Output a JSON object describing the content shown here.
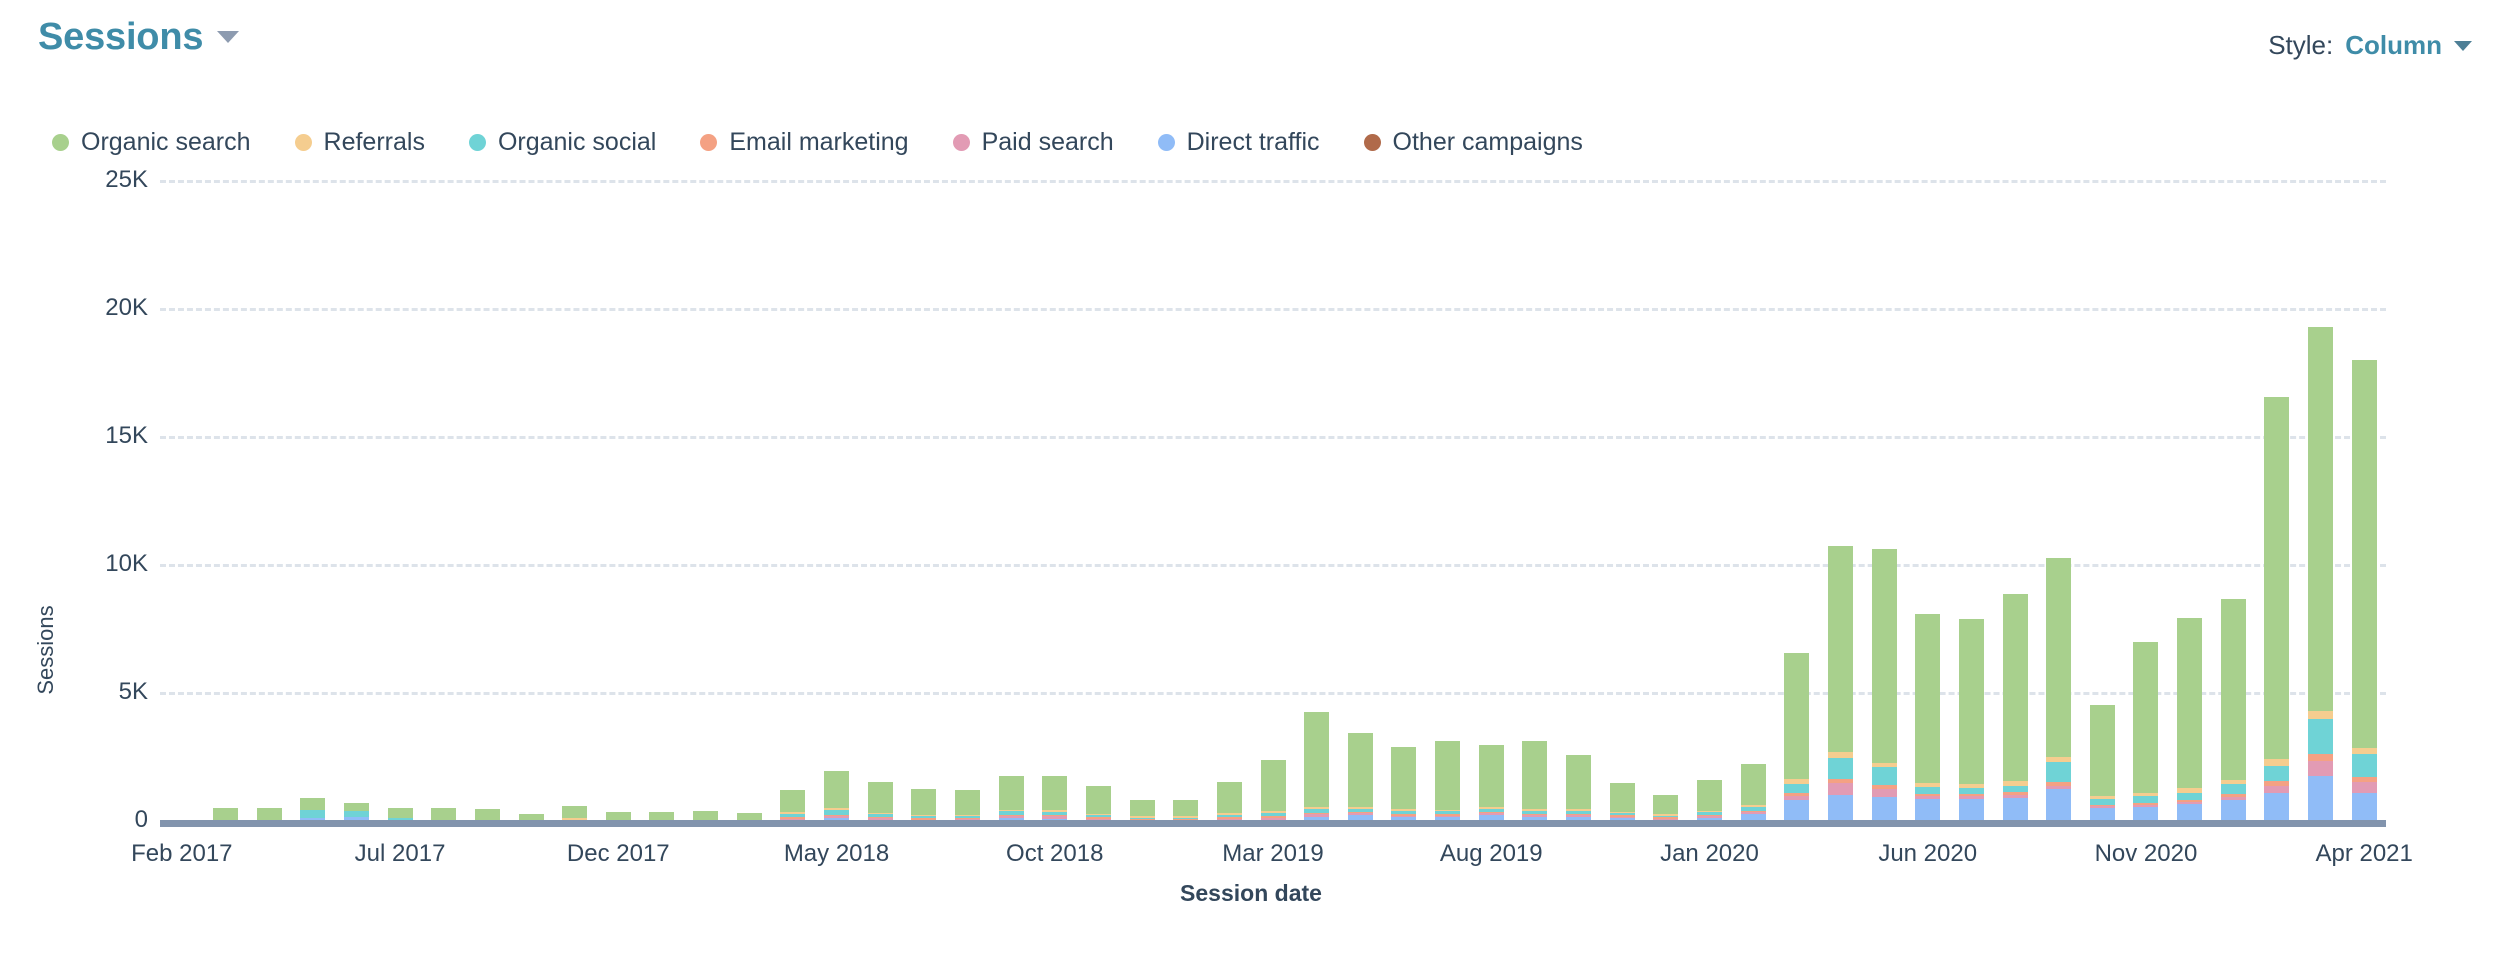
{
  "header": {
    "metric_title": "Sessions",
    "metric_caret_icon": "chevron-down-icon",
    "style_label": "Style:",
    "style_value": "Column",
    "style_caret_icon": "chevron-down-icon"
  },
  "legend": {
    "items": [
      {
        "label": "Organic search",
        "color": "#a8d08d"
      },
      {
        "label": "Referrals",
        "color": "#f5cd8f"
      },
      {
        "label": "Organic social",
        "color": "#6fd3d6"
      },
      {
        "label": "Email marketing",
        "color": "#f4a183"
      },
      {
        "label": "Paid search",
        "color": "#e29bb4"
      },
      {
        "label": "Direct traffic",
        "color": "#90bcf7"
      },
      {
        "label": "Other campaigns",
        "color": "#b06a4a"
      }
    ]
  },
  "chart_data": {
    "type": "bar",
    "stacked": true,
    "title": "Sessions",
    "xlabel": "Session date",
    "ylabel": "Sessions",
    "ylim": [
      0,
      25000
    ],
    "ytick_values": [
      0,
      5000,
      10000,
      15000,
      20000,
      25000
    ],
    "ytick_labels": [
      "0",
      "5K",
      "10K",
      "15K",
      "20K",
      "25K"
    ],
    "grid": true,
    "grid_style": "dashed-horizontal",
    "legend_position": "top-left",
    "xtick_labels": [
      "Feb 2017",
      "Jul 2017",
      "Dec 2017",
      "May 2018",
      "Oct 2018",
      "Mar 2019",
      "Aug 2019",
      "Jan 2020",
      "Jun 2020",
      "Nov 2020",
      "Apr 2021"
    ],
    "xtick_indices": [
      0,
      5,
      10,
      15,
      20,
      25,
      30,
      35,
      40,
      45,
      50
    ],
    "categories": [
      "Feb 2017",
      "Mar 2017",
      "Apr 2017",
      "May 2017",
      "Jun 2017",
      "Jul 2017",
      "Aug 2017",
      "Sep 2017",
      "Oct 2017",
      "Nov 2017",
      "Dec 2017",
      "Jan 2018",
      "Feb 2018",
      "Mar 2018",
      "Apr 2018",
      "May 2018",
      "Jun 2018",
      "Jul 2018",
      "Aug 2018",
      "Sep 2018",
      "Oct 2018",
      "Nov 2018",
      "Dec 2018",
      "Jan 2019",
      "Feb 2019",
      "Mar 2019",
      "Apr 2019",
      "May 2019",
      "Jun 2019",
      "Jul 2019",
      "Aug 2019",
      "Sep 2019",
      "Oct 2019",
      "Nov 2019",
      "Dec 2019",
      "Jan 2020",
      "Feb 2020",
      "Mar 2020",
      "Apr 2020",
      "May 2020",
      "Jun 2020",
      "Jul 2020",
      "Aug 2020",
      "Sep 2020",
      "Oct 2020",
      "Nov 2020",
      "Dec 2020",
      "Jan 2021",
      "Feb 2021",
      "Mar 2021",
      "Apr 2021"
    ],
    "series": [
      {
        "name": "Direct traffic",
        "color": "#90bcf7",
        "values": [
          10,
          60,
          20,
          330,
          340,
          170,
          60,
          100,
          30,
          40,
          50,
          60,
          60,
          50,
          230,
          330,
          250,
          180,
          200,
          300,
          290,
          230,
          150,
          140,
          210,
          230,
          350,
          420,
          350,
          340,
          420,
          370,
          370,
          300,
          220,
          330,
          480,
          1000,
          1200,
          1150,
          1050,
          1050,
          1100,
          1450,
          700,
          750,
          850,
          1000,
          1300,
          1950,
          1300
        ]
      },
      {
        "name": "Paid search",
        "color": "#e29bb4",
        "values": [
          0,
          0,
          0,
          0,
          0,
          0,
          0,
          0,
          0,
          30,
          0,
          0,
          0,
          0,
          20,
          30,
          20,
          20,
          20,
          90,
          90,
          60,
          20,
          20,
          80,
          100,
          110,
          70,
          60,
          50,
          70,
          60,
          60,
          40,
          30,
          40,
          60,
          170,
          480,
          310,
          110,
          110,
          110,
          130,
          70,
          80,
          70,
          130,
          250,
          600,
          410
        ]
      },
      {
        "name": "Email marketing",
        "color": "#f4a183",
        "values": [
          0,
          0,
          0,
          0,
          0,
          0,
          0,
          0,
          0,
          40,
          0,
          0,
          0,
          0,
          20,
          20,
          20,
          20,
          20,
          30,
          30,
          20,
          20,
          20,
          30,
          40,
          50,
          40,
          40,
          40,
          50,
          40,
          40,
          30,
          20,
          30,
          60,
          130,
          160,
          140,
          110,
          110,
          110,
          150,
          70,
          80,
          80,
          120,
          220,
          280,
          200
        ]
      },
      {
        "name": "Organic social",
        "color": "#6fd3d6",
        "values": [
          0,
          0,
          0,
          310,
          260,
          160,
          40,
          0,
          0,
          60,
          70,
          60,
          60,
          40,
          130,
          180,
          100,
          90,
          70,
          120,
          110,
          80,
          60,
          50,
          90,
          110,
          140,
          120,
          110,
          110,
          130,
          110,
          110,
          90,
          60,
          90,
          130,
          350,
          820,
          690,
          250,
          220,
          260,
          780,
          200,
          250,
          310,
          380,
          580,
          1350,
          900
        ]
      },
      {
        "name": "Referrals",
        "color": "#f5cd8f",
        "values": [
          0,
          0,
          0,
          0,
          0,
          0,
          50,
          60,
          0,
          30,
          50,
          40,
          40,
          30,
          60,
          70,
          50,
          50,
          40,
          60,
          60,
          50,
          40,
          30,
          60,
          70,
          80,
          70,
          70,
          60,
          80,
          70,
          70,
          50,
          40,
          50,
          80,
          170,
          230,
          190,
          160,
          150,
          170,
          200,
          120,
          140,
          160,
          180,
          260,
          330,
          250
        ]
      },
      {
        "name": "Organic search",
        "color": "#a8d08d",
        "values": [
          20,
          640,
          640,
          450,
          300,
          390,
          510,
          510,
          410,
          480,
          380,
          350,
          400,
          330,
          880,
          1450,
          1200,
          1010,
          950,
          1340,
          1360,
          1060,
          630,
          640,
          1230,
          2020,
          3700,
          2900,
          2420,
          2690,
          2400,
          2660,
          2100,
          1130,
          750,
          1210,
          1600,
          4950,
          8050,
          8350,
          6600,
          6450,
          7300,
          7780,
          3550,
          5900,
          6660,
          7050,
          14150,
          15000,
          15150
        ]
      },
      {
        "name": "Other campaigns",
        "color": "#b06a4a",
        "values": [
          0,
          0,
          0,
          0,
          0,
          0,
          0,
          0,
          0,
          0,
          0,
          0,
          0,
          0,
          0,
          0,
          0,
          0,
          0,
          0,
          0,
          0,
          0,
          0,
          0,
          0,
          0,
          0,
          0,
          0,
          0,
          0,
          0,
          0,
          0,
          0,
          0,
          0,
          0,
          0,
          0,
          0,
          0,
          0,
          0,
          0,
          0,
          0,
          0,
          0,
          0
        ]
      }
    ]
  }
}
